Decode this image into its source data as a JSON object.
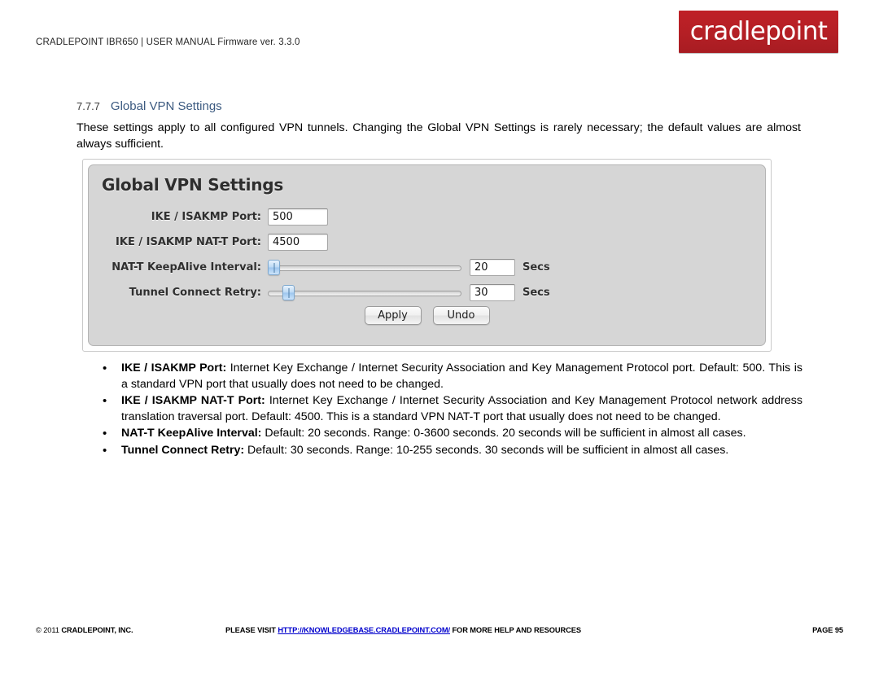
{
  "header": {
    "breadcrumb": "CRADLEPOINT IBR650 | USER MANUAL Firmware ver. 3.3.0",
    "logo_text": "cradlepoint",
    "logo_color": "#b9202a"
  },
  "section": {
    "number": "7.7.7",
    "title": "Global VPN Settings",
    "title_color": "#3c5a80",
    "intro": "These settings apply to all configured VPN tunnels. Changing the Global VPN Settings is rarely necessary; the default values are almost always sufficient."
  },
  "panel": {
    "title": "Global VPN Settings",
    "fields": [
      {
        "label": "IKE / ISAKMP Port:",
        "value": "500",
        "type": "text",
        "unit": ""
      },
      {
        "label": "IKE / ISAKMP NAT-T Port:",
        "value": "4500",
        "type": "text",
        "unit": ""
      },
      {
        "label": "NAT-T KeepAlive Interval:",
        "value": "20",
        "type": "slider",
        "unit": "Secs",
        "handle_percent": 0
      },
      {
        "label": "Tunnel Connect Retry:",
        "value": "30",
        "type": "slider",
        "unit": "Secs",
        "handle_percent": 8
      }
    ],
    "buttons": {
      "apply": "Apply",
      "undo": "Undo"
    }
  },
  "bullets": [
    {
      "term": "IKE / ISAKMP Port:",
      "text": " Internet Key Exchange / Internet Security Association and Key Management Protocol port. Default: 500. This is a standard VPN port that usually does not need to be changed."
    },
    {
      "term": "IKE / ISAKMP NAT-T Port:",
      "text": " Internet Key Exchange / Internet Security Association and Key Management Protocol network address translation traversal port. Default: 4500. This is a standard VPN NAT-T port that usually does not need to be changed."
    },
    {
      "term": "NAT-T KeepAlive Interval:",
      "text": " Default: 20 seconds. Range: 0-3600 seconds. 20 seconds will be sufficient in almost all cases."
    },
    {
      "term": "Tunnel Connect Retry:",
      "text": " Default: 30 seconds. Range: 10-255 seconds. 30 seconds will be sufficient in almost all cases."
    }
  ],
  "footer": {
    "copyright_prefix": "© 2011 ",
    "copyright_bold": "CRADLEPOINT, INC.",
    "center_before": "PLEASE VISIT ",
    "center_link": "HTTP://KNOWLEDGEBASE.CRADLEPOINT.COM/",
    "center_after": " FOR MORE HELP AND RESOURCES",
    "page": "PAGE 95"
  }
}
